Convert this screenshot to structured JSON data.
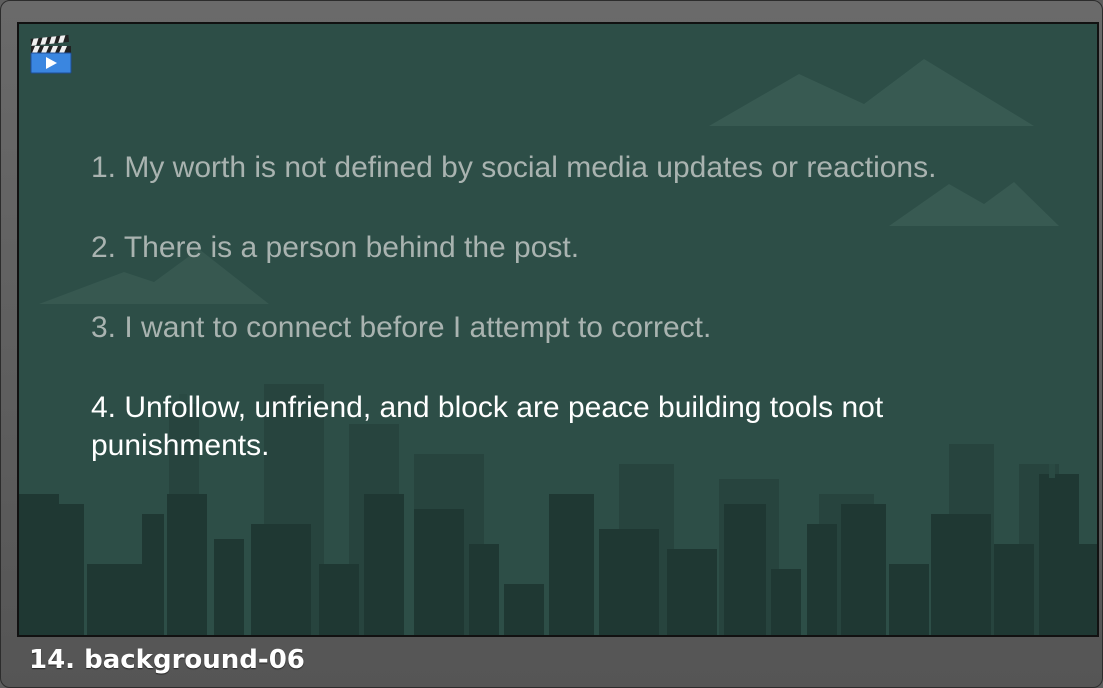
{
  "slide": {
    "items": [
      {
        "text": "1. My worth is not defined by social media updates or reactions.",
        "state": "dim"
      },
      {
        "text": "2. There is a person behind the post.",
        "state": "dim"
      },
      {
        "text": "3. I want to connect before I attempt to correct.",
        "state": "dim"
      },
      {
        "text": "4. Unfollow, unfriend, and block are peace building tools not punishments.",
        "state": "active"
      }
    ]
  },
  "caption": "14. background-06",
  "icons": {
    "media": "clapperboard-play-icon"
  },
  "colors": {
    "slide_background": "#2d4e47",
    "dim_text": "#a9b3b0",
    "active_text": "#ffffff",
    "frame": "#5e5e5e"
  }
}
